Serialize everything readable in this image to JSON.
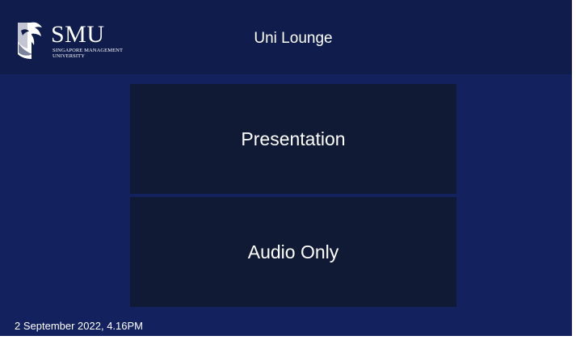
{
  "brand": {
    "logo_text": "SMU",
    "logo_subtext": "SINGAPORE MANAGEMENT\nUNIVERSITY",
    "logo_icon": "smu-lion-icon"
  },
  "header": {
    "title": "Uni Lounge"
  },
  "modes": {
    "presentation_label": "Presentation",
    "audio_only_label": "Audio Only"
  },
  "status": {
    "datetime": "2 September 2022, 4.16PM"
  },
  "colors": {
    "background": "#13215e",
    "header": "#0f1c4c",
    "button": "#111a35",
    "text": "#ffffff"
  }
}
